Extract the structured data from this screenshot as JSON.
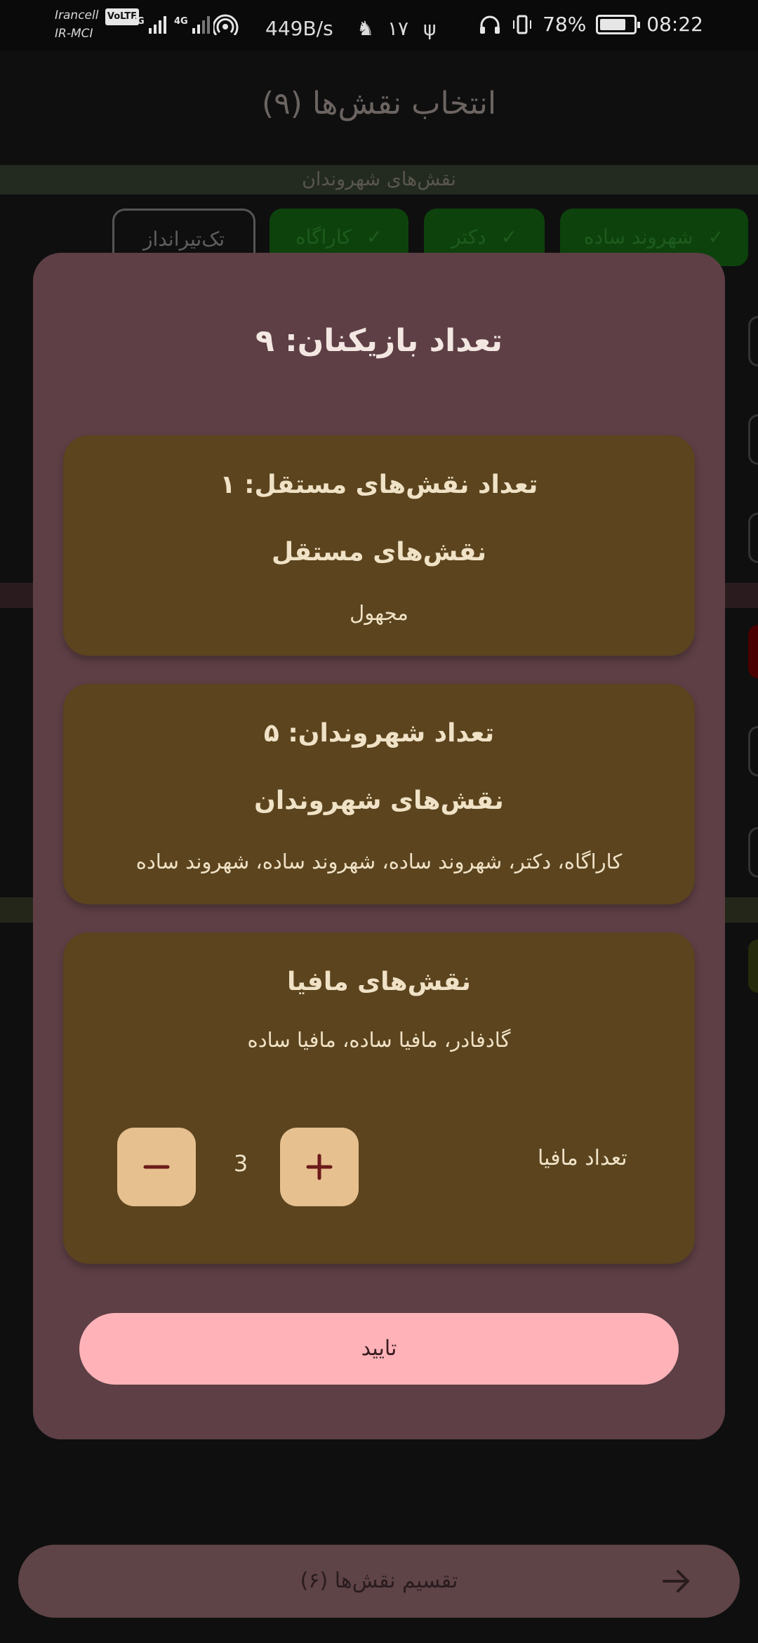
{
  "status_bar": {
    "carrier_top": "Irancell",
    "volte": "VoLTE",
    "carrier_bottom": "IR-MCI",
    "net1": "4G",
    "net2": "4G",
    "speed": "449B/s",
    "notif_count": "۱۷",
    "battery": "78%",
    "battery_level": 0.78,
    "time": "08:22"
  },
  "background": {
    "title": "انتخاب نقش‌ها (۹)",
    "section_label": "نقش‌های شهروندان",
    "chips": [
      {
        "label": "شهروند ساده",
        "selected": true
      },
      {
        "label": "دکتر",
        "selected": true
      },
      {
        "label": "کاراگاه",
        "selected": true
      },
      {
        "label": "تک‌تیرانداز",
        "selected": false
      }
    ],
    "bottom_button": "تقسیم نقش‌ها (۶)"
  },
  "dialog": {
    "title": "تعداد بازیکنان: ۹",
    "independent": {
      "count_label": "تعداد نقش‌های مستقل: ۱",
      "heading": "نقش‌های مستقل",
      "roles": "مجهول"
    },
    "citizens": {
      "count_label": "تعداد شهروندان: ۵",
      "heading": "نقش‌های شهروندان",
      "roles": "کاراگاه، دکتر، شهروند ساده، شهروند ساده، شهروند ساده"
    },
    "mafia": {
      "heading": "نقش‌های مافیا",
      "roles": "گادفادر، مافیا ساده، مافیا ساده",
      "count_label": "تعداد مافیا",
      "count_value": "3"
    },
    "confirm": "تایید"
  },
  "colors": {
    "dialog_bg": "#5d3f45",
    "card_bg": "#5b441e",
    "stepper_bg": "#e7c08f",
    "confirm_bg": "#ffb3b8"
  }
}
